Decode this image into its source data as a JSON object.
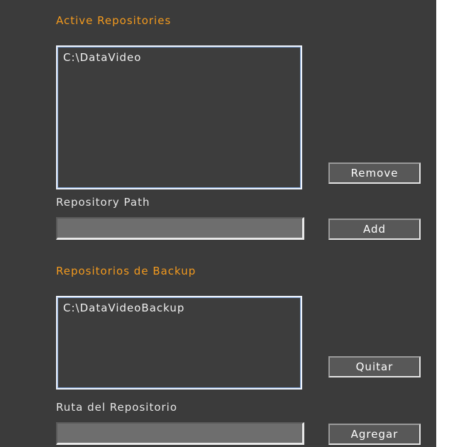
{
  "active": {
    "title": "Active Repositories",
    "items": [
      "C:\\DataVideo"
    ],
    "remove_label": "Remove",
    "path_label": "Repository Path",
    "path_value": "",
    "add_label": "Add"
  },
  "backup": {
    "title": "Repositorios de Backup",
    "items": [
      "C:\\DataVideoBackup"
    ],
    "remove_label": "Quitar",
    "path_label": "Ruta del Repositorio",
    "path_value": "",
    "add_label": "Agregar"
  },
  "colors": {
    "panel_bg": "#3b3b3b",
    "title_orange": "#f39a1e",
    "text": "#e6e6e6"
  }
}
